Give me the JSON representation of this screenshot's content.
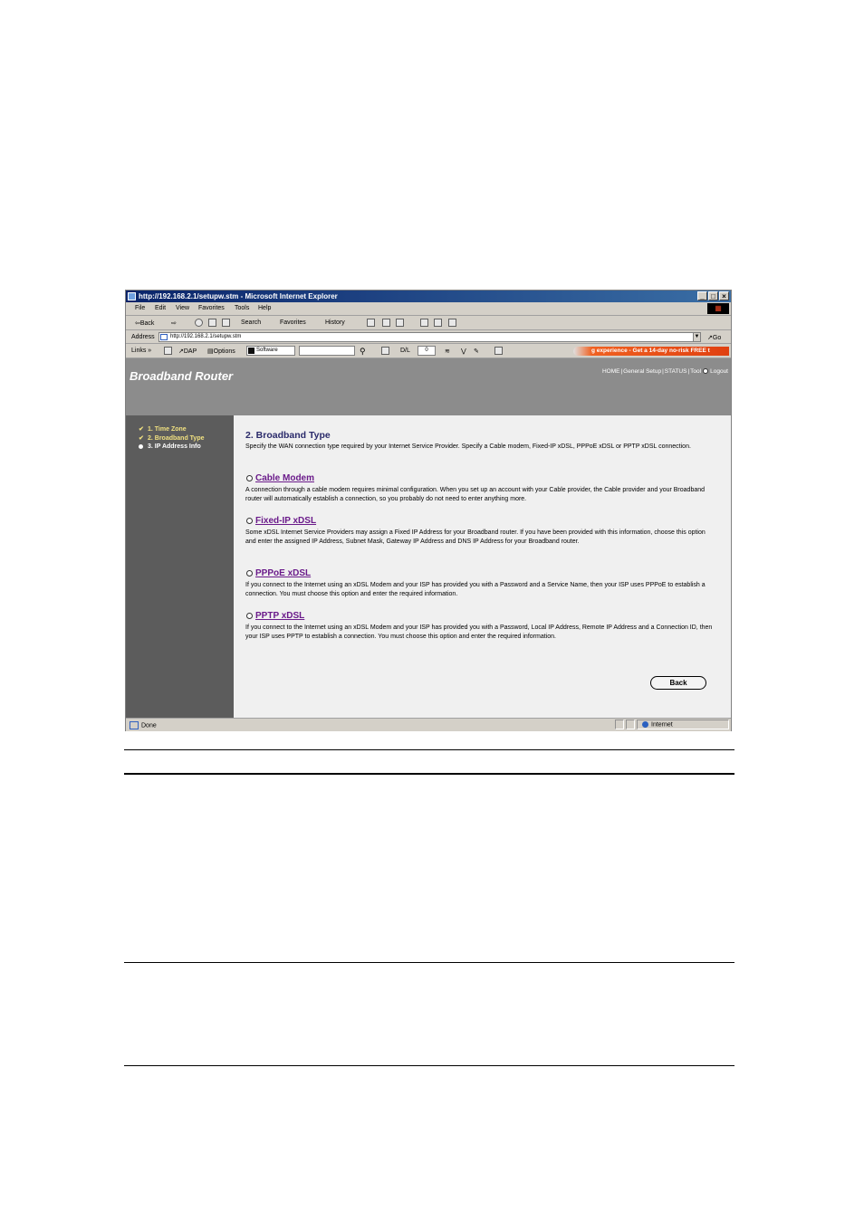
{
  "window": {
    "title": "http://192.168.2.1/setupw.stm - Microsoft Internet Explorer",
    "buttons": [
      "_",
      "□",
      "×"
    ]
  },
  "menu": [
    "File",
    "Edit",
    "View",
    "Favorites",
    "Tools",
    "Help"
  ],
  "toolbar": {
    "back": "⇦Back",
    "forward": "⇨",
    "search": "Search",
    "favorites": "Favorites",
    "history": "History"
  },
  "address": {
    "label": "Address",
    "url": "http://192.168.2.1/setupw.stm",
    "go": "Go"
  },
  "links_bar": {
    "links": "Links »",
    "dap": "DAP",
    "options": "Options",
    "software": "Software",
    "dl": "D/L",
    "dl_count": "0",
    "promo": "g experience - Get a 14-day no-risk FREE t"
  },
  "router": {
    "brand": "Broadband Router",
    "nav": [
      "HOME",
      "General Setup",
      "STATUS",
      "Tool",
      "Logout"
    ],
    "steps": [
      {
        "mark": "✔",
        "label": "1. Time Zone"
      },
      {
        "mark": "✔",
        "label": "2. Broadband Type"
      },
      {
        "mark": "",
        "label": "3. IP Address Info"
      }
    ],
    "title": "2. Broadband Type",
    "description": "Specify the WAN connection type required by your Internet Service Provider. Specify a Cable modem, Fixed-IP xDSL, PPPoE xDSL or PPTP xDSL connection.",
    "options": [
      {
        "label": "Cable Modem",
        "desc": "A connection through a cable modem requires minimal configuration. When you set up an account with your Cable provider, the Cable provider and your Broadband router will automatically establish a connection, so you probably do not need to enter anything more."
      },
      {
        "label": "Fixed-IP xDSL",
        "desc": "Some xDSL Internet Service Providers may assign a Fixed IP Address for your Broadband router. If you have been provided with this information, choose this option and enter the assigned IP Address, Subnet Mask, Gateway IP Address and DNS IP Address for your Broadband router."
      },
      {
        "label": "PPPoE xDSL",
        "desc": "If you connect to the Internet using an xDSL Modem and your ISP has provided you with a Password and a Service Name, then your ISP uses PPPoE to establish a connection. You must choose this option and enter the required information."
      },
      {
        "label": "PPTP xDSL",
        "desc": "If you connect to the Internet using an xDSL Modem and your ISP has provided you with a Password, Local IP Address, Remote IP Address and a Connection ID, then your ISP uses PPTP to establish a connection. You must choose this option and enter the required information."
      }
    ],
    "back": "Back"
  },
  "status": {
    "left": "Done",
    "zone": "Internet"
  }
}
